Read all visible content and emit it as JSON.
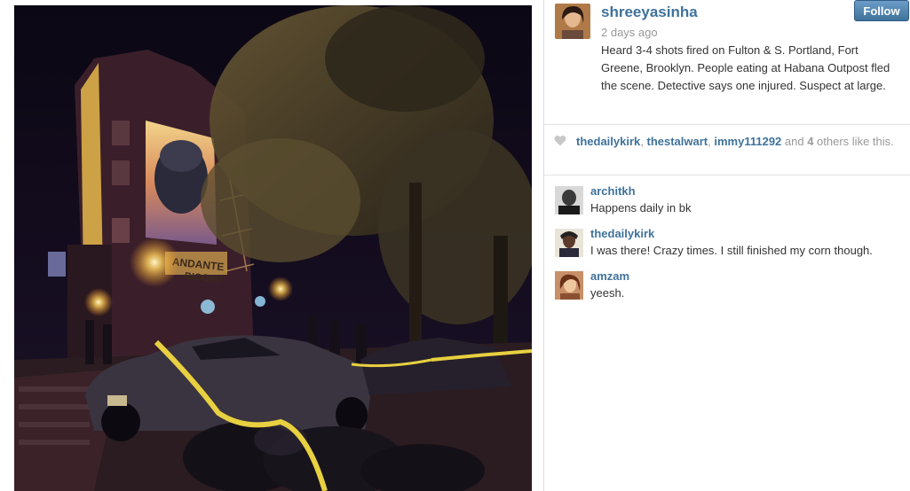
{
  "post": {
    "username": "shreeyasinha",
    "time_ago": "2 days ago",
    "caption": "Heard 3-4 shots fired on Fulton & S. Portland, Fort Greene, Brooklyn. People eating at Habana Outpost fled the scene. Detective says one injured. Suspect at large.",
    "follow_label": "Follow",
    "photo": {
      "mural_text_1": "ANDANTE",
      "mural_text_2": "BIGGIE!"
    }
  },
  "likes": {
    "user_1": "thedailykirk",
    "sep_1": ", ",
    "user_2": "thestalwart",
    "sep_2": ", ",
    "user_3": "immy111292",
    "and_text": " and ",
    "others_count": "4",
    "others_text": " others like this."
  },
  "comments": [
    {
      "username": "architkh",
      "text": "Happens daily in bk"
    },
    {
      "username": "thedailykirk",
      "text": "I was there! Crazy times. I still finished my corn though."
    },
    {
      "username": "amzam",
      "text": "yeesh."
    }
  ],
  "colors": {
    "link": "#3f729b",
    "follow_button": "#3f729b",
    "meta_text": "#999999"
  },
  "icons": {
    "like": "heart-icon"
  }
}
